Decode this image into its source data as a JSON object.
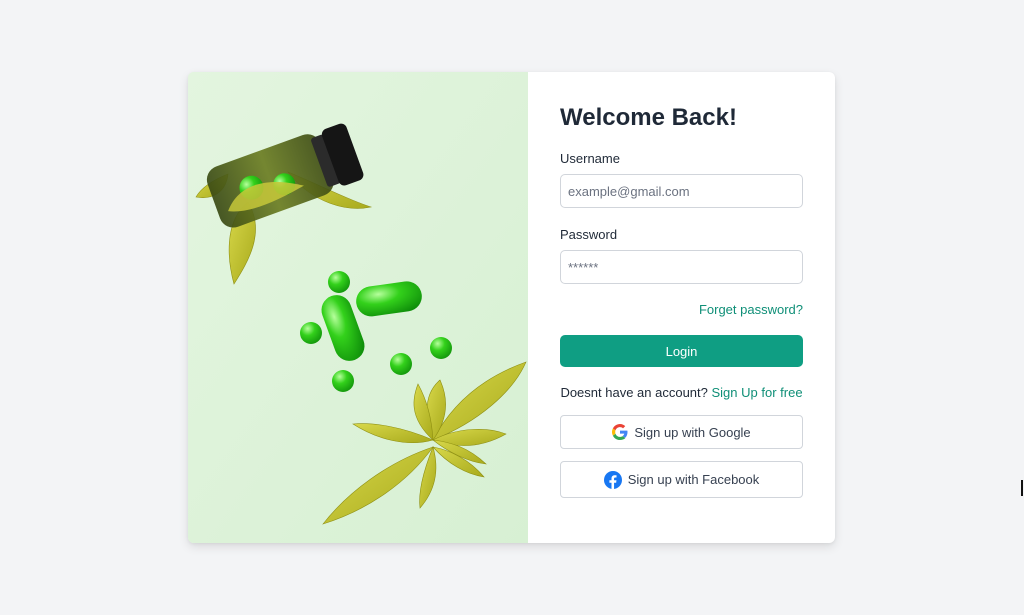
{
  "login": {
    "title": "Welcome Back!",
    "username_label": "Username",
    "username_placeholder": "example@gmail.com",
    "password_label": "Password",
    "password_placeholder": "******",
    "forgot_label": "Forget password?",
    "login_label": "Login",
    "signup_prompt": "Doesnt have an account?",
    "signup_link": "Sign Up for free",
    "google_label": "Sign up with Google",
    "facebook_label": "Sign up with Facebook"
  },
  "hero": {
    "image": "pills-bottle-leaves-image"
  },
  "colors": {
    "accent": "#0f9e83",
    "link": "#0f8f77",
    "hero_bg": "#dcf3d9",
    "page_bg": "#f3f4f6"
  }
}
